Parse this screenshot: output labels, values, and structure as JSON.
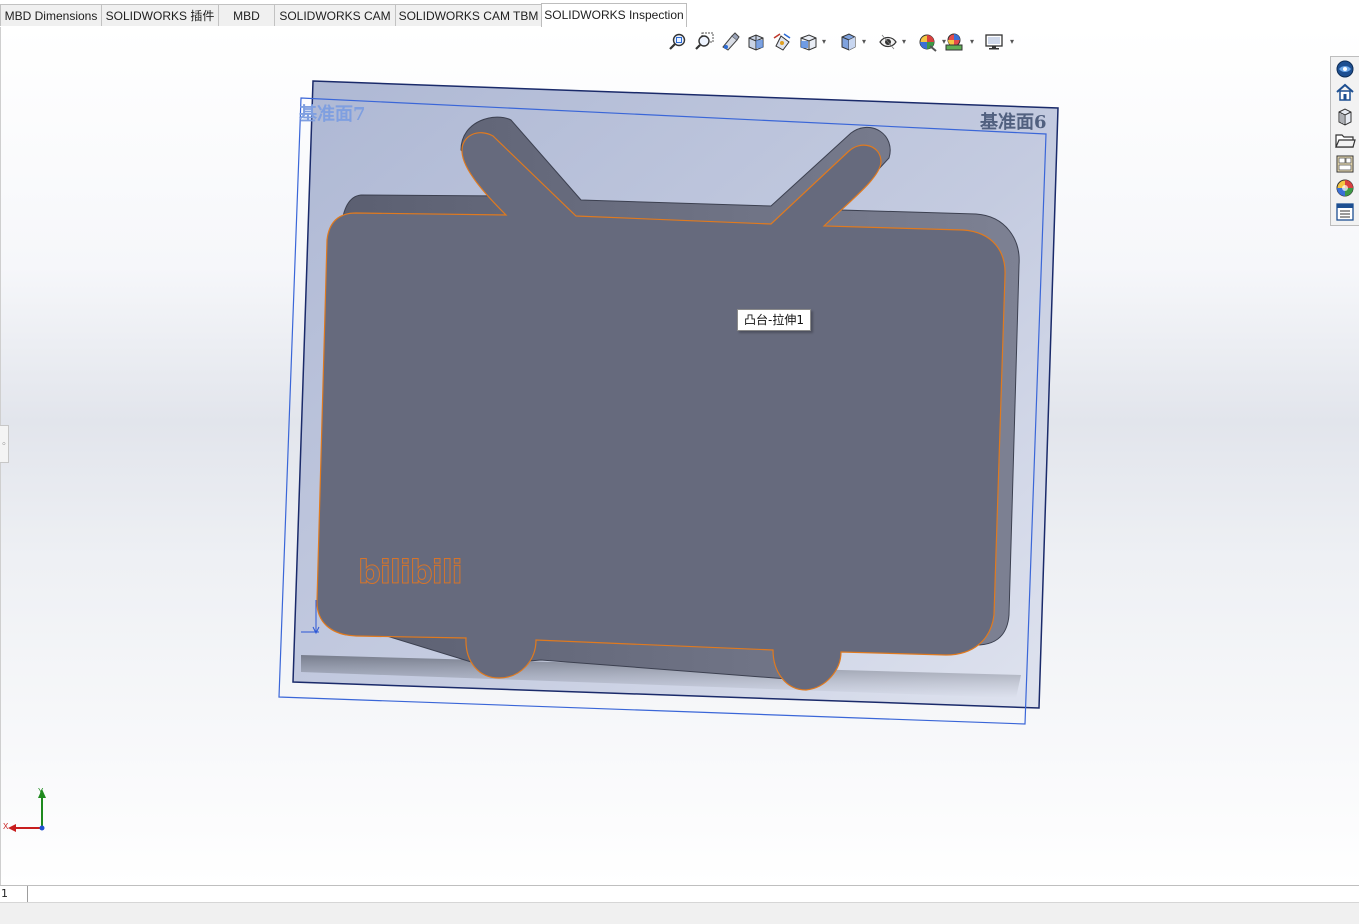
{
  "tabs": [
    {
      "label": "MBD Dimensions",
      "active": false
    },
    {
      "label": "SOLIDWORKS 插件",
      "active": false
    },
    {
      "label": "MBD",
      "active": false
    },
    {
      "label": "SOLIDWORKS CAM",
      "active": false
    },
    {
      "label": "SOLIDWORKS CAM TBM",
      "active": false
    },
    {
      "label": "SOLIDWORKS Inspection",
      "active": true
    }
  ],
  "view_toolbar_icons": [
    "zoom-to-fit-icon",
    "zoom-to-area-icon",
    "previous-view-icon",
    "section-view-icon",
    "dynamic-annotation-views-icon",
    "view-orientation-icon",
    "display-style-icon",
    "hide-show-items-icon",
    "edit-appearance-icon",
    "apply-scene-icon",
    "view-settings-icon"
  ],
  "task_pane_icons": [
    "solidworks-resources-icon",
    "home-icon",
    "design-library-icon",
    "file-explorer-icon",
    "view-palette-icon",
    "appearances-scenes-icon",
    "custom-properties-icon"
  ],
  "model": {
    "plane_front_label": "基准面7",
    "plane_back_label": "基准面6",
    "logo_text": "bilibili",
    "tooltip": "凸台-拉伸1",
    "body_color": "#666a7d",
    "edge_color": "#e07a1f",
    "plane_fill": "#b3bcd6",
    "plane_edge": "#1a2a6a"
  },
  "triad": {
    "x_label": "X",
    "y_label": "Y"
  },
  "bottom_tab": {
    "label": "1"
  }
}
